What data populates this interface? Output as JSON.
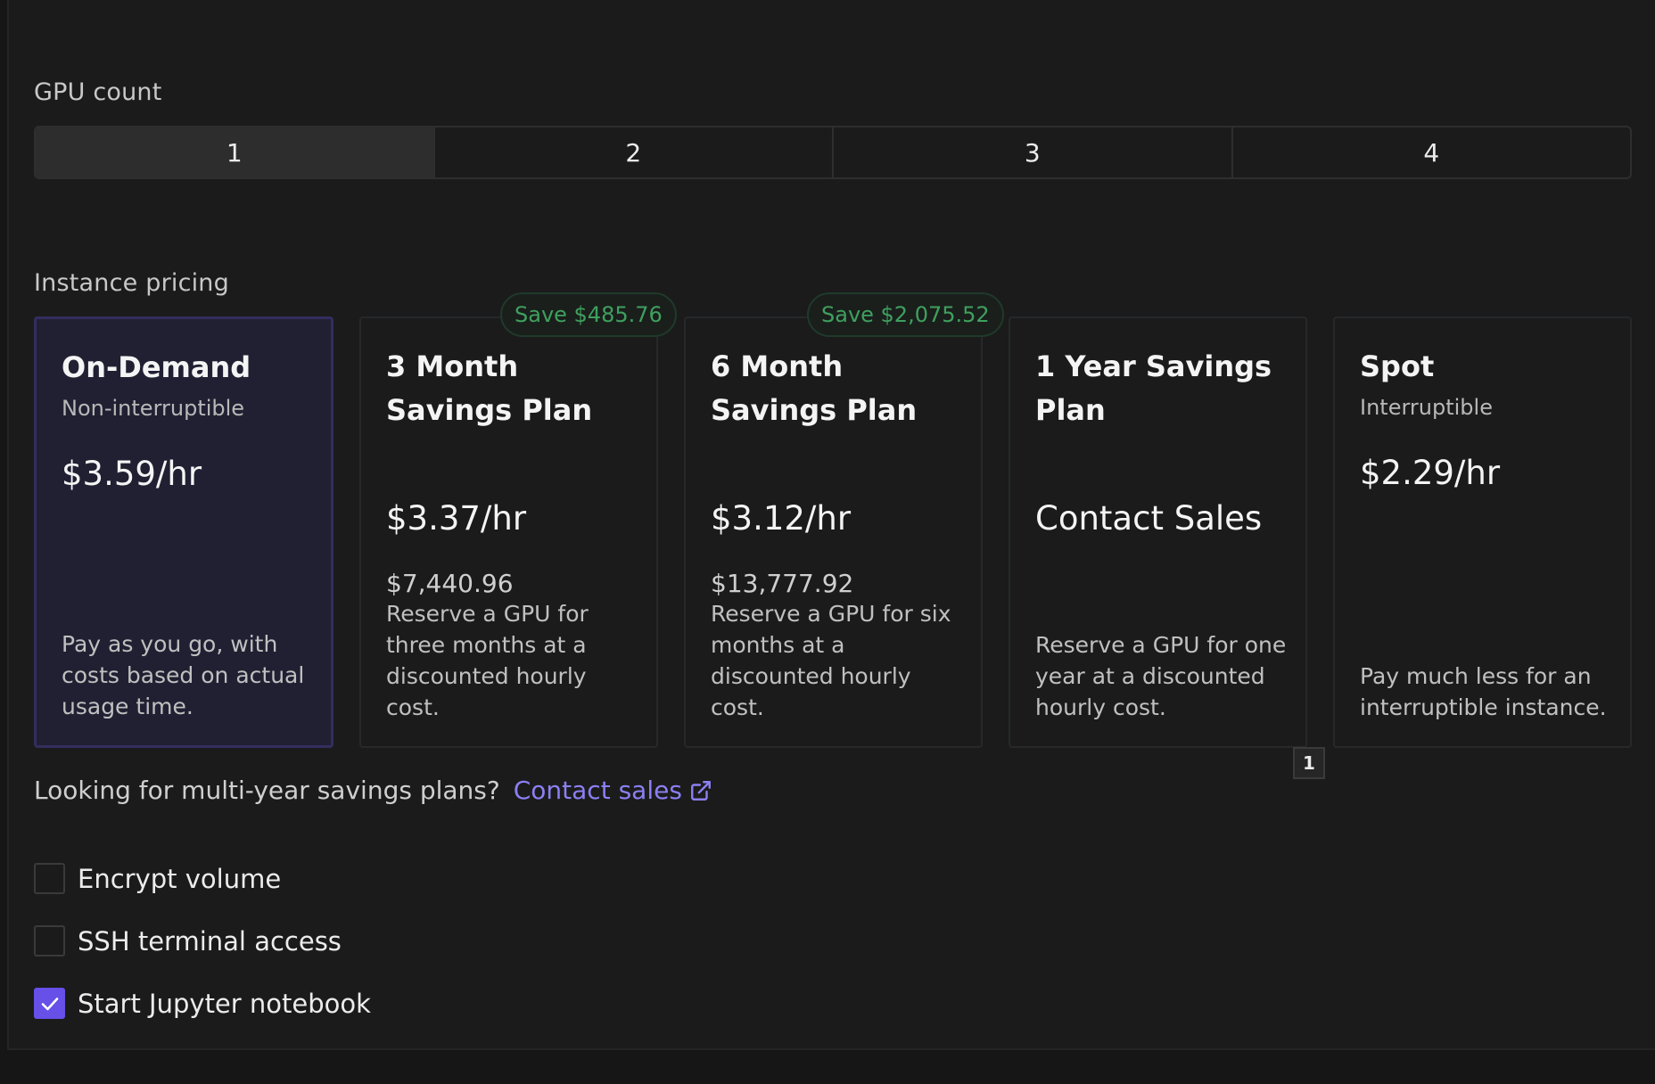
{
  "gpu_count": {
    "label": "GPU count",
    "options": [
      "1",
      "2",
      "3",
      "4"
    ],
    "selected": "1"
  },
  "pricing": {
    "label": "Instance pricing",
    "plans": [
      {
        "name": "On-Demand",
        "subtitle": "Non-interruptible",
        "price": "$3.59/hr",
        "description": "Pay as you go, with costs based on actual usage time.",
        "selected": true
      },
      {
        "name": "3 Month Savings Plan",
        "badge": "Save $485.76",
        "price": "$3.37/hr",
        "total": "$7,440.96",
        "description": "Reserve a GPU for three months at a discounted hourly cost."
      },
      {
        "name": "6 Month Savings Plan",
        "badge": "Save $2,075.52",
        "price": "$3.12/hr",
        "total": "$13,777.92",
        "description": "Reserve a GPU for six months at a discounted hourly cost."
      },
      {
        "name": "1 Year Savings Plan",
        "price": "Contact Sales",
        "description": "Reserve a GPU for one year at a discounted hourly cost."
      },
      {
        "name": "Spot",
        "subtitle": "Interruptible",
        "price": "$2.29/hr",
        "description": "Pay much less for an interruptible instance."
      }
    ],
    "index_badge": "1"
  },
  "multiyear": {
    "text": "Looking for multi-year savings plans?",
    "link": "Contact sales",
    "link_icon": "external-link-icon"
  },
  "options": [
    {
      "label": "Encrypt volume",
      "checked": false
    },
    {
      "label": "SSH terminal access",
      "checked": false
    },
    {
      "label": "Start Jupyter notebook",
      "checked": true
    }
  ],
  "colors": {
    "accent": "#6650e8",
    "link": "#8b80f3",
    "save_green": "#3fa05e",
    "selected_card_bg": "#212033"
  }
}
